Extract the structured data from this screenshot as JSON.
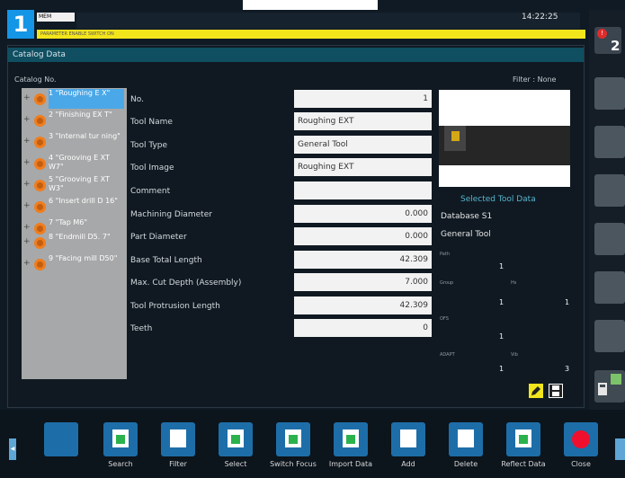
{
  "header": {
    "channel": "1",
    "mode": "MEM",
    "alarm_text": "PARAMETER ENABLE SWITCH ON",
    "clock": "14:22:25"
  },
  "alarms": {
    "badge": "!",
    "count": "2"
  },
  "panel": {
    "title": "Catalog Data",
    "catalog_label": "Catalog No.",
    "filter_label": "Filter : None"
  },
  "tree": {
    "items": [
      {
        "expander": "+",
        "label": "1 \"Roughing E X\"",
        "selected": true
      },
      {
        "expander": "+",
        "label": "2 \"Finishing EX T\""
      },
      {
        "expander": "+",
        "label": "3 \"Internal tur ning\""
      },
      {
        "expander": "+",
        "label": "4 \"Grooving E XT W7\""
      },
      {
        "expander": "+",
        "label": "5 \"Grooving E XT W3\""
      },
      {
        "expander": "+",
        "label": "6 \"Insert drill D 16\""
      },
      {
        "expander": "+",
        "label": "7 \"Tap M6\""
      },
      {
        "expander": "+",
        "label": "8 \"Endmill D5. 7\""
      },
      {
        "expander": "+",
        "label": "9 \"Facing mill D50\""
      }
    ]
  },
  "fields": [
    {
      "label": "No.",
      "value": "1",
      "numeric": true
    },
    {
      "label": "Tool Name",
      "value": "Roughing EXT",
      "numeric": false
    },
    {
      "label": "Tool Type",
      "value": "General Tool",
      "numeric": false
    },
    {
      "label": "Tool Image",
      "value": "Roughing EXT",
      "numeric": false
    },
    {
      "label": "Comment",
      "value": "",
      "numeric": false
    },
    {
      "label": "Machining Diameter",
      "value": "0.000",
      "numeric": true
    },
    {
      "label": "Part Diameter",
      "value": "0.000",
      "numeric": true
    },
    {
      "label": "Base Total Length",
      "value": "42.309",
      "numeric": true
    },
    {
      "label": "Max. Cut Depth (Assembly)",
      "value": "7.000",
      "numeric": true
    },
    {
      "label": "Tool Protrusion Length",
      "value": "42.309",
      "numeric": true
    },
    {
      "label": "Teeth",
      "value": "0",
      "numeric": true
    }
  ],
  "selected_tool": {
    "title": "Selected Tool Data",
    "database": "Database S1",
    "type": "General Tool",
    "items": [
      {
        "label": "Path",
        "value": "1"
      },
      {
        "label": "Group",
        "value": "1"
      },
      {
        "label": "Hs",
        "value": "1"
      },
      {
        "label": "OFS",
        "value": "1"
      },
      {
        "label": "ADAPT",
        "value": "1"
      },
      {
        "label": "Vib",
        "value": "3"
      }
    ]
  },
  "toolbar": {
    "buttons": [
      {
        "label": "",
        "icon": "blank"
      },
      {
        "label": "Search",
        "icon": "search-icon"
      },
      {
        "label": "Filter",
        "icon": "filter-icon"
      },
      {
        "label": "Select",
        "icon": "select-icon"
      },
      {
        "label": "Switch Focus",
        "icon": "switch-focus-icon"
      },
      {
        "label": "Import Data",
        "icon": "import-icon"
      },
      {
        "label": "Add",
        "icon": "add-icon"
      },
      {
        "label": "Delete",
        "icon": "delete-icon"
      },
      {
        "label": "Reflect Data",
        "icon": "reflect-icon"
      },
      {
        "label": "Close",
        "icon": "close-icon"
      }
    ]
  },
  "colors": {
    "accent": "#1495e6",
    "alarm_bar": "#f3e51c",
    "header_teal": "#0f4f61",
    "selected_item": "#4aa8e8",
    "tool_icon_orange": "#f07d1d",
    "close_red": "#f0102d"
  }
}
